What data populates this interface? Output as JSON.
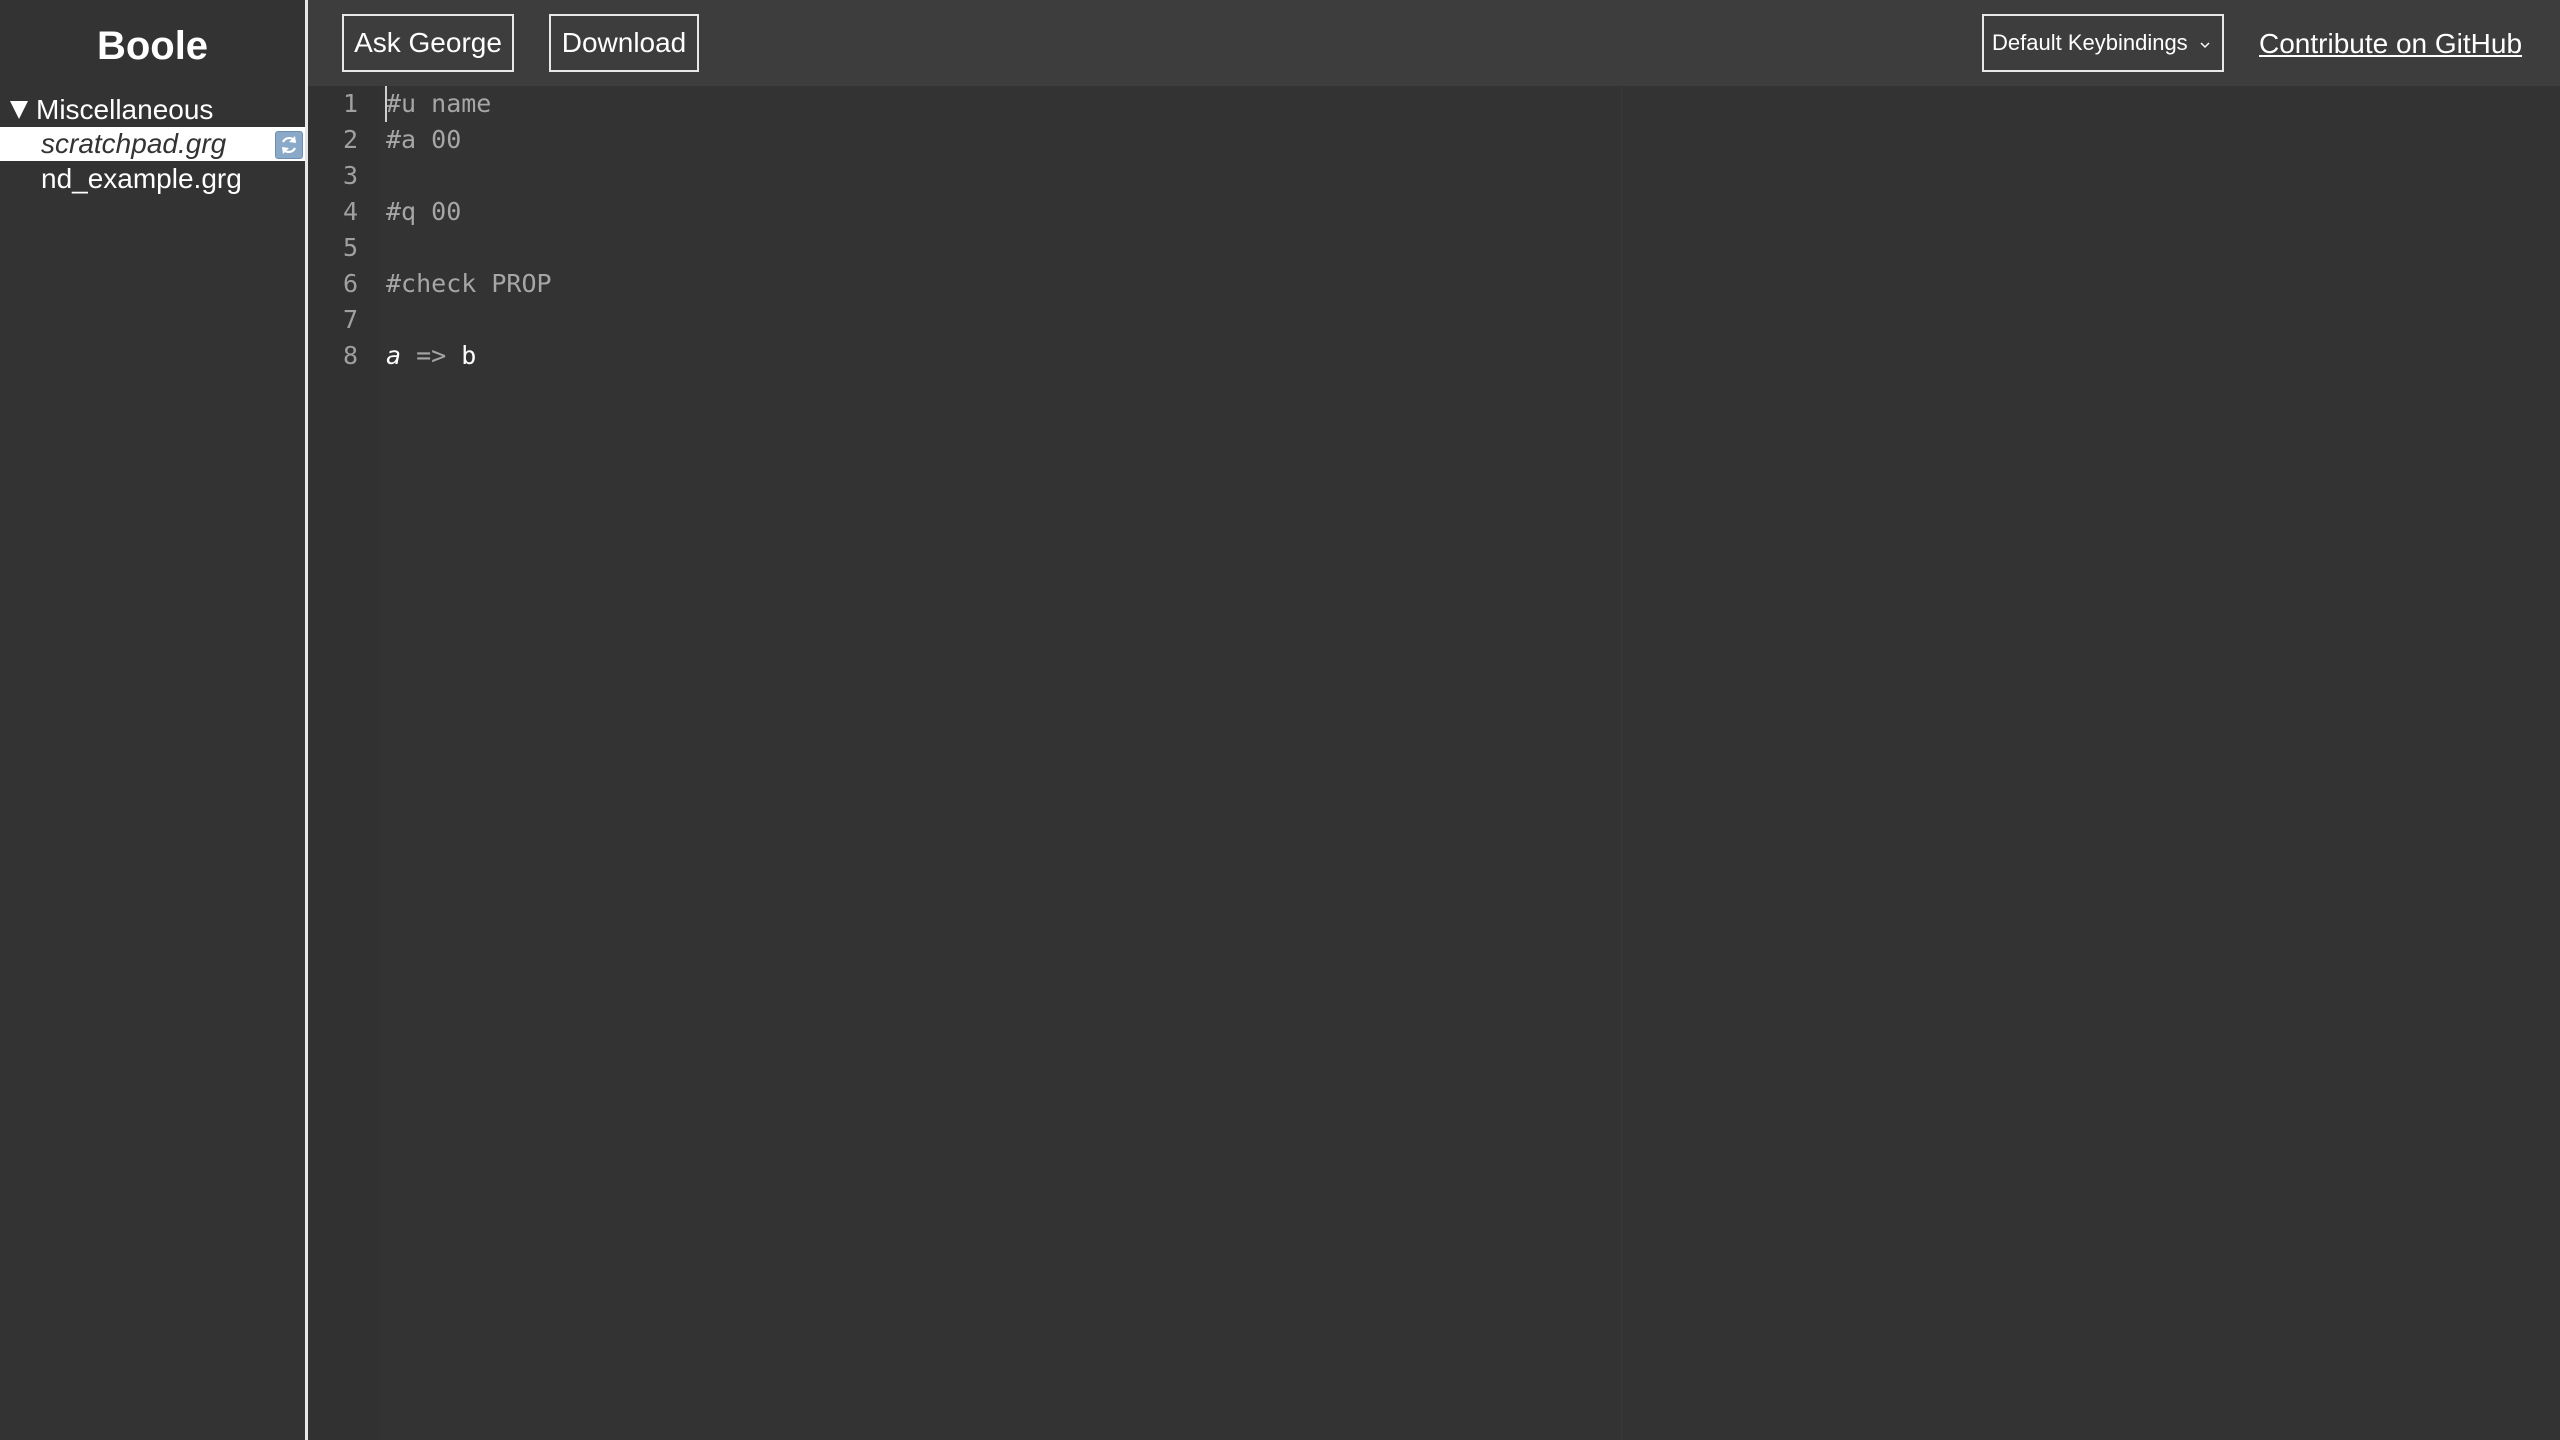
{
  "sidebar": {
    "brand": "Boole",
    "folder": "Miscellaneous",
    "files": [
      {
        "label": "scratchpad.grg",
        "active": true
      },
      {
        "label": "nd_example.grg",
        "active": false
      }
    ]
  },
  "toolbar": {
    "ask_label": "Ask George",
    "download_label": "Download",
    "keybindings_selected": "Default Keybindings",
    "github_link": "Contribute on GitHub"
  },
  "editor": {
    "line_numbers": [
      "1",
      "2",
      "3",
      "4",
      "5",
      "6",
      "7",
      "8"
    ],
    "lines": [
      "#u name",
      "#a 00",
      "",
      "#q 00",
      "",
      "#check PROP",
      "",
      "a => b"
    ],
    "line8_tokens": {
      "var_a": "a",
      "op": "=>",
      "var_b": "b"
    }
  },
  "icons": {
    "folder_toggle": "triangle-down-icon",
    "file_action": "reload-icon",
    "select_chevron": "chevron-down-icon"
  },
  "colors": {
    "background": "#333333",
    "toolbar": "#3d3d3d",
    "text": "#ffffff",
    "comment": "#a6a6a6",
    "line_number": "#a0a0a0"
  }
}
